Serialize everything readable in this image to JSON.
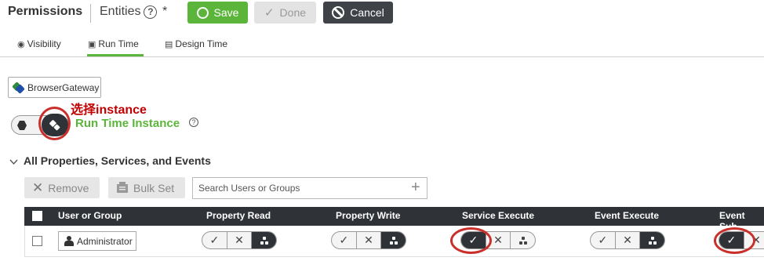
{
  "header": {
    "title": "Permissions",
    "entities_label": "Entities",
    "help_glyph": "?",
    "unsaved_marker": "*",
    "save_label": "Save",
    "done_label": "Done",
    "cancel_label": "Cancel",
    "colors": {
      "save": "#5bb53b",
      "cancel": "#3f4347",
      "done": "#e3e3e3"
    }
  },
  "tabs": [
    {
      "label": "Visibility",
      "icon": "visibility-icon",
      "active": false
    },
    {
      "label": "Run Time",
      "icon": "run-time-icon",
      "active": true
    },
    {
      "label": "Design Time",
      "icon": "design-time-icon",
      "active": false
    }
  ],
  "instance_chip": {
    "label": "BrowserGateway",
    "icon": "thing-instance-icon"
  },
  "annotation": {
    "text": "选择instance",
    "color": "#c00000"
  },
  "runtime_instance": {
    "title": "Run Time Instance",
    "help_glyph": "?",
    "title_color": "#5bb53b"
  },
  "section": {
    "title": "All Properties, Services, and Events",
    "remove_label": "Remove",
    "bulk_set_label": "Bulk Set",
    "search_placeholder": "Search Users or Groups"
  },
  "table": {
    "columns": [
      "User or Group",
      "Property Read",
      "Property Write",
      "Service Execute",
      "Event Execute",
      "Event Sub"
    ],
    "rows": [
      {
        "user": "Administrator",
        "permissions": [
          {
            "column": "Property Read",
            "state": "inherit"
          },
          {
            "column": "Property Write",
            "state": "inherit"
          },
          {
            "column": "Service Execute",
            "state": "allow"
          },
          {
            "column": "Event Execute",
            "state": "inherit"
          },
          {
            "column": "Event Sub",
            "state": "allow"
          }
        ]
      }
    ],
    "header_color": "#2f3236",
    "highlight_color": "#c9302c"
  },
  "glyphs": {
    "check": "✓",
    "cross": "✕"
  }
}
